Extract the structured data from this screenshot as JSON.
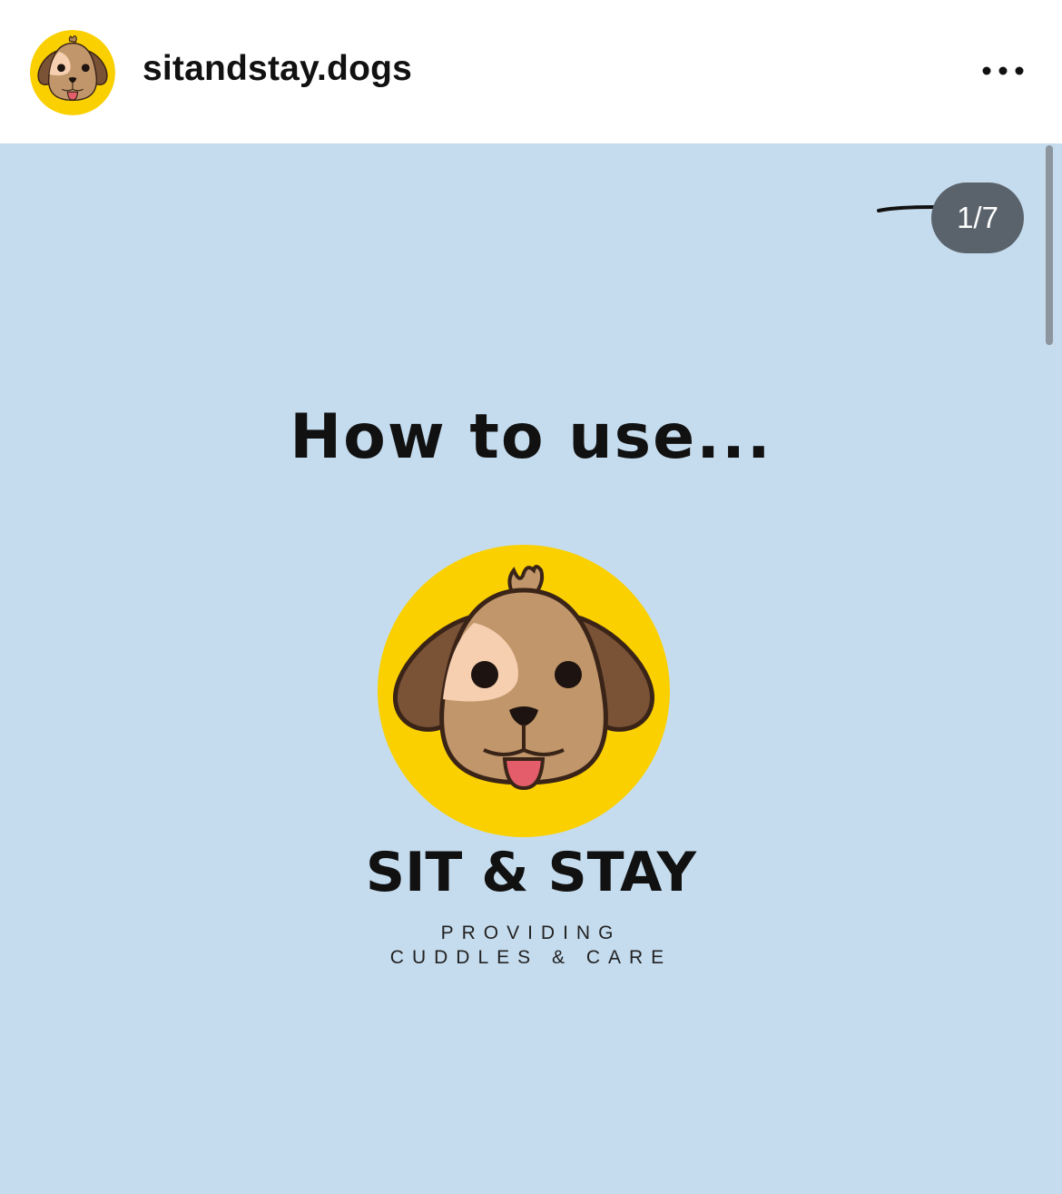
{
  "colors": {
    "post_background": "#c5dcee",
    "logo_circle": "#fad000",
    "counter_badge": "#5a636b"
  },
  "header": {
    "username": "sitandstay.dogs",
    "avatar_icon": "dog-face-icon",
    "more_icon": "more-horizontal-icon"
  },
  "post": {
    "counter": "1/7",
    "headline": "How to use...",
    "brand_name": "SIT & STAY",
    "tagline_line1": "PROVIDING",
    "tagline_line2": "CUDDLES & CARE",
    "logo_icon": "dog-face-icon"
  }
}
